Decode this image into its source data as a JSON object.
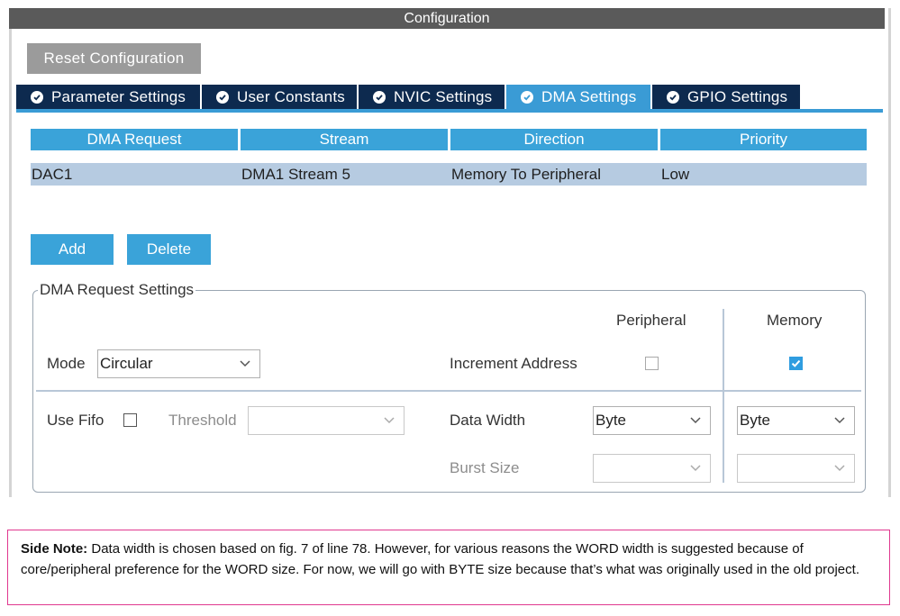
{
  "window": {
    "title": "Configuration"
  },
  "toolbar": {
    "reset_label": "Reset Configuration"
  },
  "tabs": [
    {
      "label": "Parameter Settings",
      "active": false
    },
    {
      "label": "User Constants",
      "active": false
    },
    {
      "label": "NVIC Settings",
      "active": false
    },
    {
      "label": "DMA Settings",
      "active": true
    },
    {
      "label": "GPIO Settings",
      "active": false
    }
  ],
  "dma_table": {
    "headers": [
      "DMA Request",
      "Stream",
      "Direction",
      "Priority"
    ],
    "rows": [
      [
        "DAC1",
        "DMA1 Stream 5",
        "Memory To Peripheral",
        "Low"
      ]
    ]
  },
  "actions": {
    "add_label": "Add",
    "delete_label": "Delete"
  },
  "request_settings": {
    "legend": "DMA Request Settings",
    "peripheral_header": "Peripheral",
    "memory_header": "Memory",
    "mode_label": "Mode",
    "mode_value": "Circular",
    "increment_label": "Increment Address",
    "peripheral_increment_checked": false,
    "memory_increment_checked": true,
    "use_fifo_label": "Use Fifo",
    "use_fifo_checked": false,
    "threshold_label": "Threshold",
    "threshold_value": "",
    "data_width_label": "Data Width",
    "peripheral_data_width": "Byte",
    "memory_data_width": "Byte",
    "burst_size_label": "Burst Size",
    "peripheral_burst_size": "",
    "memory_burst_size": ""
  },
  "side_note": {
    "bold": "Side Note:",
    "text": " Data width is chosen based on fig. 7 of line 78. However, for various reasons the WORD width is suggested because of core/peripheral preference for the WORD size. For now, we will go with BYTE size because that’s what was originally used in the old project."
  },
  "colors": {
    "title_bar": "#5a5a5a",
    "tab_inactive": "#0d2a4f",
    "tab_active": "#3a9bd5",
    "table_header": "#3aa3d9",
    "table_row": "#b6cbe1",
    "note_border": "#e0388f"
  }
}
